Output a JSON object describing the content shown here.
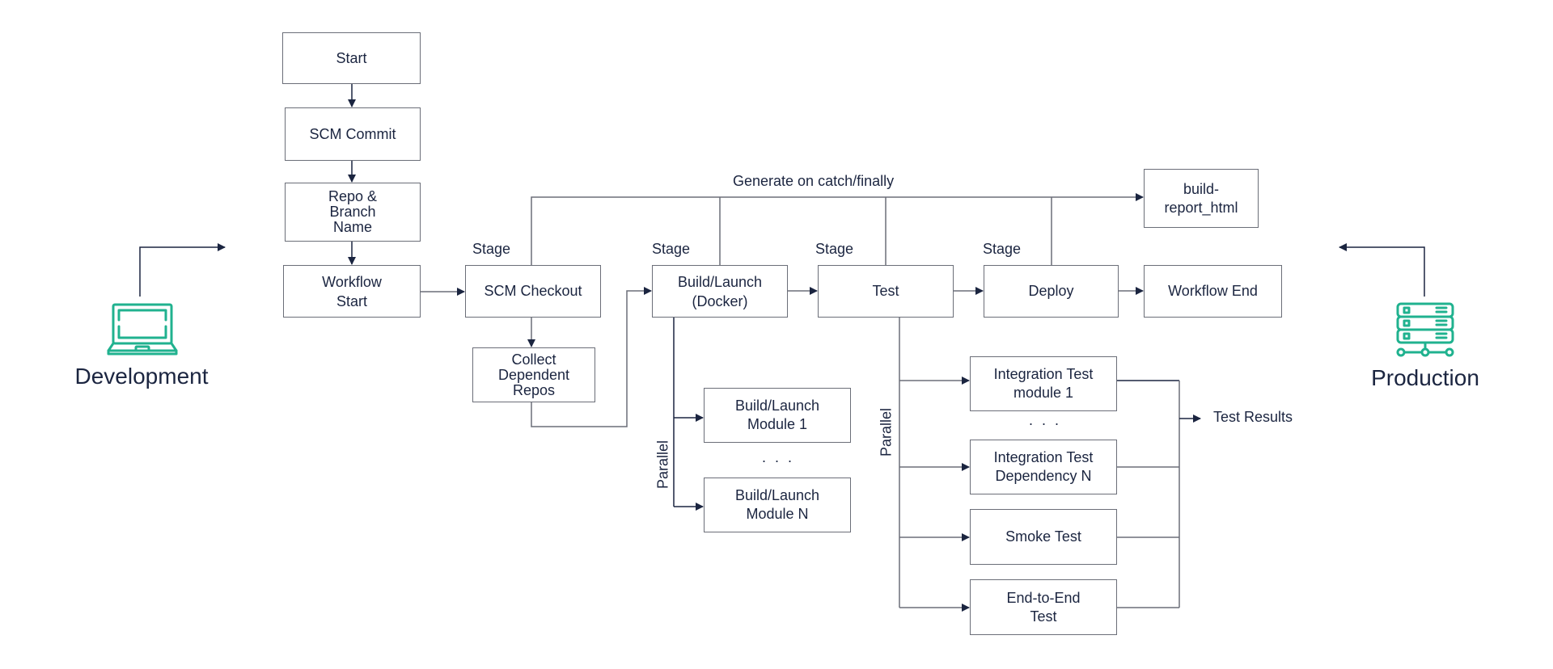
{
  "diagram": {
    "accent_color": "#20b28f",
    "line_color": "#6b6e78",
    "text_color": "#1b2540",
    "environments": {
      "development": {
        "label": "Development",
        "icon": "laptop-icon"
      },
      "production": {
        "label": "Production",
        "icon": "server-icon"
      }
    },
    "nodes": {
      "start": "Start",
      "scm_commit": "SCM Commit",
      "repo_branch": "Repo &\nBranch\nName",
      "workflow_start": "Workflow\nStart",
      "scm_checkout": "SCM Checkout",
      "collect_repos": "Collect\nDependent\nRepos",
      "build_launch": "Build/Launch\n(Docker)",
      "build_module_1": "Build/Launch\nModule 1",
      "build_module_n": "Build/Launch\nModule N",
      "test": "Test",
      "integration_module_1": "Integration Test\nmodule 1",
      "integration_dependency_n": "Integration Test\nDependency N",
      "smoke_test": "Smoke Test",
      "end_to_end_test": "End-to-End\nTest",
      "deploy": "Deploy",
      "workflow_end": "Workflow End",
      "build_report": "build-\nreport_html"
    },
    "labels": {
      "stage": "Stage",
      "generate": "Generate on catch/finally",
      "parallel": "Parallel",
      "ellipsis": ". . .",
      "test_results": "Test Results"
    }
  }
}
